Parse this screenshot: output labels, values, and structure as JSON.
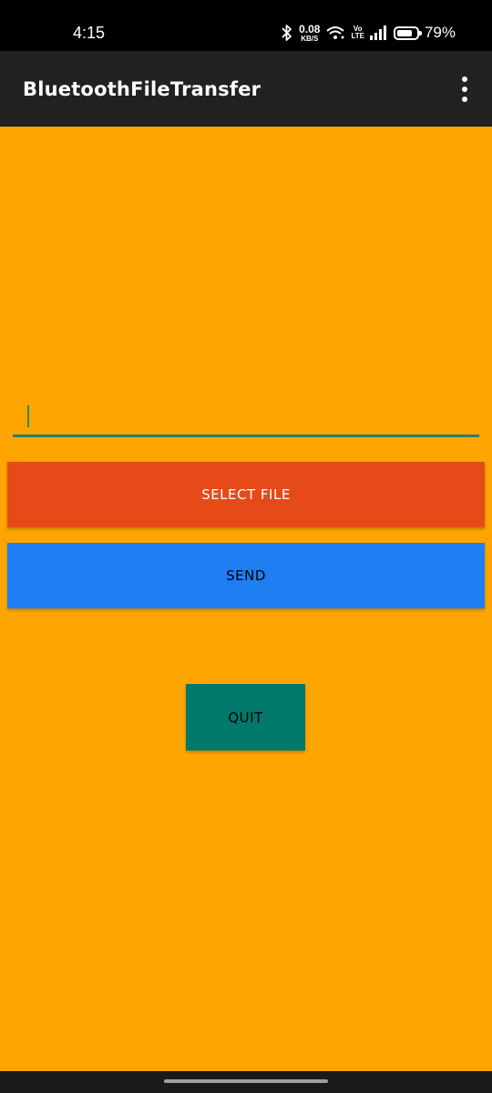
{
  "status_bar": {
    "time": "4:15",
    "net_speed_value": "0.08",
    "net_speed_unit": "KB/S",
    "volte_top": "Vo",
    "volte_bottom": "LTE",
    "battery_percent": "79%",
    "battery_level": 0.79
  },
  "app_bar": {
    "title": "BluetoothFileTransfer"
  },
  "input": {
    "value": "",
    "placeholder": ""
  },
  "buttons": {
    "select_file": "SELECT FILE",
    "send": "SEND",
    "quit": "QUIT"
  },
  "colors": {
    "background": "#FFA500",
    "app_bar": "#212121",
    "select_file": "#E64A19",
    "send": "#1E7EF2",
    "quit": "#00796B",
    "accent": "#2E7D73"
  },
  "icons": {
    "bluetooth": "bluetooth-icon",
    "wifi": "wifi-icon",
    "signal": "signal-icon",
    "battery": "battery-icon",
    "menu": "overflow-menu-icon"
  }
}
